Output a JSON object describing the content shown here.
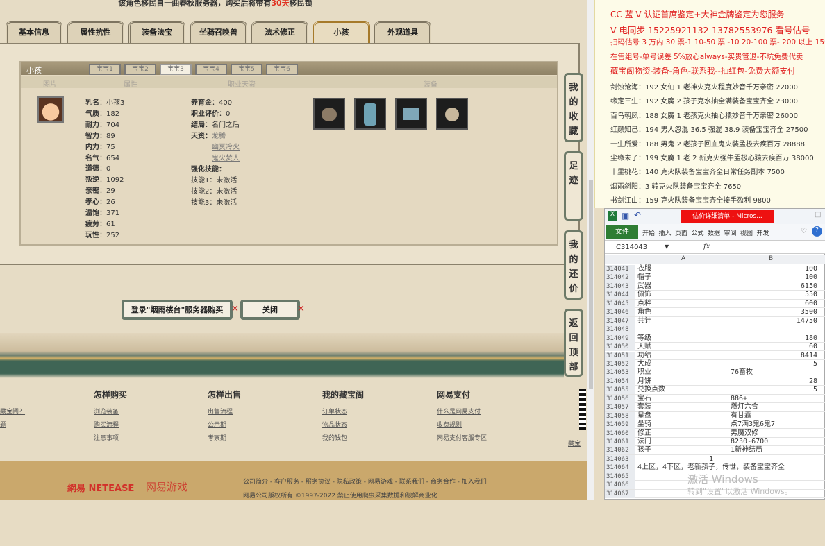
{
  "notice": {
    "pre": "该角色移民自一曲春秋服务器，购买后将带有",
    "days": "30天",
    "post": "移民锁"
  },
  "tabs": [
    "基本信息",
    "属性抗性",
    "装备法宝",
    "坐骑召唤兽",
    "法术修正",
    "小孩",
    "外观道具"
  ],
  "child_panel": {
    "title": "小孩",
    "sub_tabs": [
      "宝宝1",
      "宝宝2",
      "宝宝3",
      "宝宝4",
      "宝宝5",
      "宝宝6"
    ],
    "columns": [
      "图片",
      "属性",
      "职业天资",
      "装备"
    ],
    "attrs": [
      [
        "乳名",
        "小孩3"
      ],
      [
        "气质",
        "182"
      ],
      [
        "耐力",
        "704"
      ],
      [
        "智力",
        "89"
      ],
      [
        "内力",
        "75"
      ],
      [
        "名气",
        "654"
      ],
      [
        "道德",
        "0"
      ],
      [
        "叛逆",
        "1092"
      ],
      [
        "亲密",
        "29"
      ],
      [
        "孝心",
        "26"
      ],
      [
        "温饱",
        "371"
      ],
      [
        "疲劳",
        "61"
      ],
      [
        "玩性",
        "252"
      ]
    ],
    "career": [
      [
        "养育金",
        "400"
      ],
      [
        "职业评价",
        "0"
      ],
      [
        "结局",
        "名门之后"
      ]
    ],
    "talent_label": "天资：",
    "talents": [
      "龙腾",
      "幽冥冷火",
      "鬼火焚人"
    ],
    "skills_label": "强化技能：",
    "skills": [
      [
        "技能1",
        "未激活"
      ],
      [
        "技能2",
        "未激活"
      ],
      [
        "技能3",
        "未激活"
      ]
    ]
  },
  "side_buttons": [
    "我的收藏",
    "足迹",
    "我的还价",
    "返回顶部"
  ],
  "buttons": {
    "login": "登录\"烟雨楼台\"服务器购买",
    "close": "关闭"
  },
  "footer": {
    "cols": [
      {
        "title": "问题",
        "links": [
          "藏宝阁？",
          "题"
        ]
      },
      {
        "title": "怎样购买",
        "links": [
          "浏览装备",
          "购买流程",
          "注意事项"
        ]
      },
      {
        "title": "怎样出售",
        "links": [
          "出售流程",
          "公示期",
          "考察期"
        ]
      },
      {
        "title": "我的藏宝阁",
        "links": [
          "订单状态",
          "物品状态",
          "我的钱包"
        ]
      },
      {
        "title": "网易支付",
        "links": [
          "什么是网易支付",
          "收费规则",
          "网易支付客服专区"
        ]
      }
    ],
    "right_link": "藏宝",
    "brand1": "網易 NETEASE",
    "brand2": "网易游戏",
    "links_line": "公司简介 - 客户服务 - 服务协议 - 隐私政策 - 网易游戏 - 联系我们 - 商务合作 - 加入我们",
    "copyright": "网易公司版权所有 ©1997-2022 禁止使用爬虫采集数据和破解商业化"
  },
  "doc": {
    "red_lines": [
      "CC 蓝 V 认证首席鉴定+大神金牌鉴定为您服务",
      "V 电同步 15225921132-13782553976 看号估号",
      "扫码估号 3 万内 30 票-1 10-50 票 -10 20-100 票- 200 以上 150",
      "在售组号-单号误差 5%放心always-买贵管退-不坑免费代卖",
      "藏宝阁物资-装备-角色-联系我--抽红包-免费大额支付"
    ],
    "lines": [
      "剑蚀沧海：192 女仙 1 老神火克火程度妙音千万亲密 22000",
      "缘定三生：192 女魔 2 孩子克水抽全满装备宝宝齐全 23000",
      "百鸟朝凤：188 女魔 1 老孩克火抽心猿妙音千万亲密 26000",
      "红颜知己：194 男人忽混 36.5 强混 38.9 装备宝宝齐全 27500",
      "一生所爱：188 男鬼 2 老孩子回血鬼火装孟极去疾百万 28888",
      "尘缘未了：199 女魔 1 老 2 新克火强牛孟极心猿去疾百万 38000",
      "十里桃花：140 克火队装备宝宝齐全日常任务副本 7500",
      "烟雨斜阳：3 转克火队装备宝宝齐全 7650",
      "书剑江山：159 克火队装备宝宝齐全接手盈利 9800"
    ]
  },
  "excel": {
    "title": "估价详细清单 - Micros...",
    "file_tab": "文件",
    "ribbon": [
      "开始",
      "插入",
      "页面",
      "公式",
      "数据",
      "审阅",
      "视图",
      "开发"
    ],
    "name_box": "C314043",
    "fx": "fx",
    "col_a": "A",
    "col_b": "B",
    "rows": [
      [
        "314041",
        "衣服",
        "100"
      ],
      [
        "314042",
        "帽子",
        "100"
      ],
      [
        "314043",
        "武器",
        "6150"
      ],
      [
        "314044",
        "佩饰",
        "550"
      ],
      [
        "314045",
        "点粹",
        "600"
      ],
      [
        "314046",
        "角色",
        "3500"
      ],
      [
        "314047",
        "共计",
        "14750"
      ],
      [
        "314048",
        "",
        ""
      ],
      [
        "314049",
        "等级",
        "180"
      ],
      [
        "314050",
        "天赋",
        "60"
      ],
      [
        "314051",
        "功绩",
        "8414"
      ],
      [
        "314052",
        "大成",
        "5"
      ],
      [
        "314053",
        "职业",
        "76畜牧"
      ],
      [
        "314054",
        "月饼",
        "28"
      ],
      [
        "314055",
        "兑换点数",
        "5"
      ],
      [
        "314056",
        "宝石",
        "886+"
      ],
      [
        "314057",
        "套装",
        "燃灯六合"
      ],
      [
        "314058",
        "星盘",
        "有甘霖"
      ],
      [
        "314059",
        "坐骑",
        "点7满3鬼6鬼7"
      ],
      [
        "314060",
        "修正",
        "男魔双修"
      ],
      [
        "314061",
        "法门",
        "8230-6700"
      ],
      [
        "314062",
        "孩子",
        "1新神结局"
      ],
      [
        "314063",
        "",
        "1"
      ],
      [
        "314064",
        "4上区，4下区，老新孩子，传世，装备宝宝齐全",
        ""
      ],
      [
        "314065",
        "",
        ""
      ],
      [
        "314066",
        "",
        ""
      ],
      [
        "314067",
        "",
        ""
      ]
    ]
  },
  "watermark": {
    "line1": "激活 Windows",
    "line2": "转到\"设置\"以激活 Windows。"
  }
}
